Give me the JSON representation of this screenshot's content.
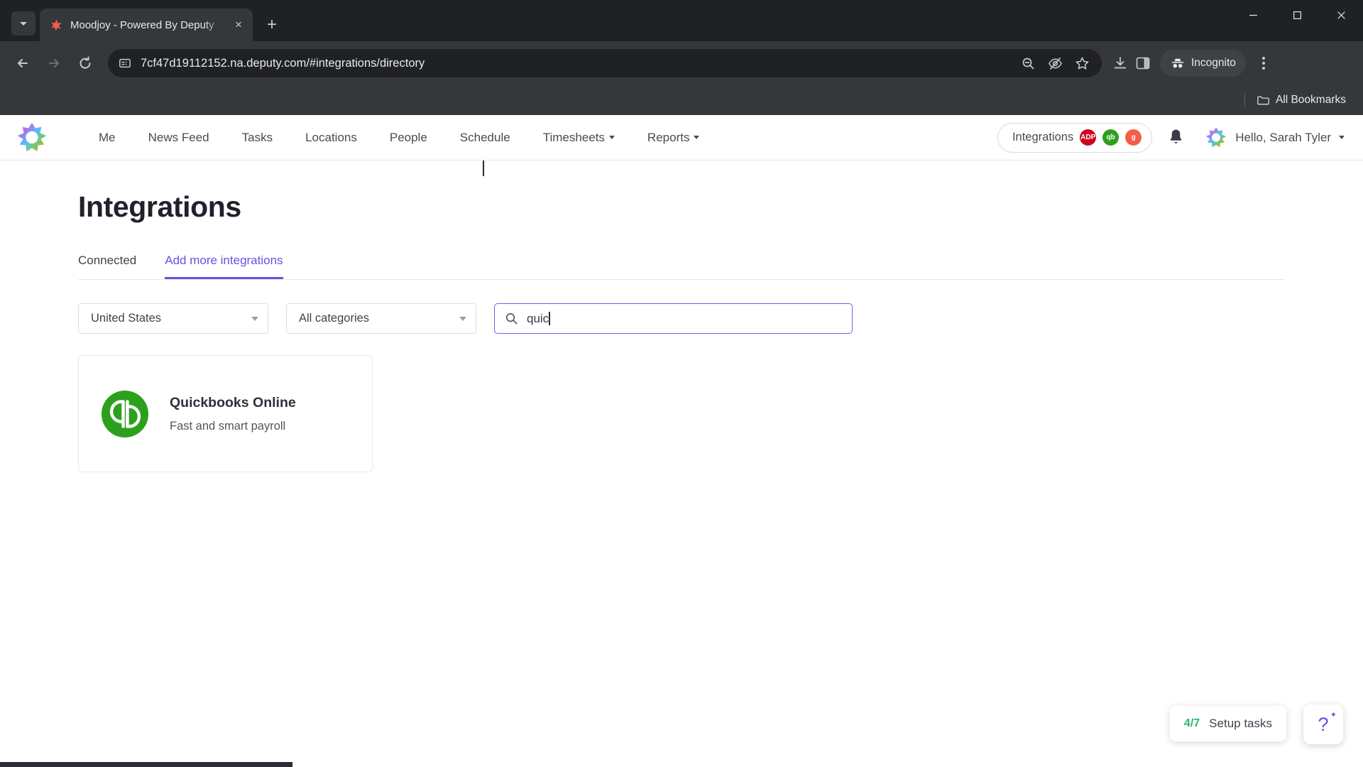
{
  "browser": {
    "tab": {
      "title": "Moodjoy - Powered By Deputy",
      "favicon_name": "moodjoy-favicon",
      "close_label": "×"
    },
    "new_tab_label": "+",
    "tab_search_name": "tab-search-icon",
    "window_controls": {
      "minimize": "—",
      "maximize": "❐",
      "close": "✕"
    },
    "toolbar": {
      "back_label": "Back",
      "forward_label": "Forward",
      "reload_label": "Reload",
      "url": "7cf47d19112152.na.deputy.com/#integrations/directory",
      "site_info_icon": "site-settings-icon",
      "zoom_out_icon": "zoom-out-icon",
      "tracking_icon": "eye-off-icon",
      "bookmark_icon": "star-icon",
      "download_icon": "download-icon",
      "sidepanel_icon": "side-panel-icon",
      "incognito_label": "Incognito",
      "menu_icon": "three-dot-menu-icon"
    },
    "bookmarks": {
      "all_bookmarks_label": "All Bookmarks",
      "folder_icon": "folder-icon"
    }
  },
  "app": {
    "logo_name": "deputy-moodjoy-logo",
    "nav_items": [
      {
        "label": "Me",
        "has_caret": false
      },
      {
        "label": "News Feed",
        "has_caret": false
      },
      {
        "label": "Tasks",
        "has_caret": false
      },
      {
        "label": "Locations",
        "has_caret": false
      },
      {
        "label": "People",
        "has_caret": false
      },
      {
        "label": "Schedule",
        "has_caret": false
      },
      {
        "label": "Timesheets",
        "has_caret": true
      },
      {
        "label": "Reports",
        "has_caret": true
      }
    ],
    "integrations_pill": {
      "label": "Integrations",
      "badges": [
        {
          "name": "adp-badge",
          "text": "ADP",
          "color": "#d0021b"
        },
        {
          "name": "quickbooks-badge",
          "text": "qb",
          "color": "#2ca01c"
        },
        {
          "name": "gusto-badge",
          "text": "g",
          "color": "#f45d48"
        }
      ]
    },
    "notifications_icon": "bell-icon",
    "user": {
      "greeting": "Hello, Sarah Tyler",
      "avatar_name": "user-avatar"
    }
  },
  "page": {
    "title": "Integrations",
    "tabs": [
      {
        "label": "Connected",
        "active": false
      },
      {
        "label": "Add more integrations",
        "active": true
      }
    ],
    "filters": {
      "country": {
        "value": "United States",
        "label": "Country filter"
      },
      "category": {
        "value": "All categories",
        "label": "Category filter"
      },
      "search": {
        "value": "quic",
        "placeholder": "",
        "icon": "search-icon"
      }
    },
    "results": [
      {
        "name": "Quickbooks Online",
        "description": "Fast and smart payroll",
        "logo_name": "quickbooks-logo",
        "logo_color": "#2ca01c"
      }
    ],
    "setup_tasks": {
      "count": "4/7",
      "label": "Setup tasks"
    },
    "help": {
      "label": "?",
      "name": "help-button"
    }
  },
  "colors": {
    "accent": "#6b4ee6",
    "chrome_dark": "#35373a",
    "chrome_darker": "#202124",
    "success": "#2bb673"
  }
}
